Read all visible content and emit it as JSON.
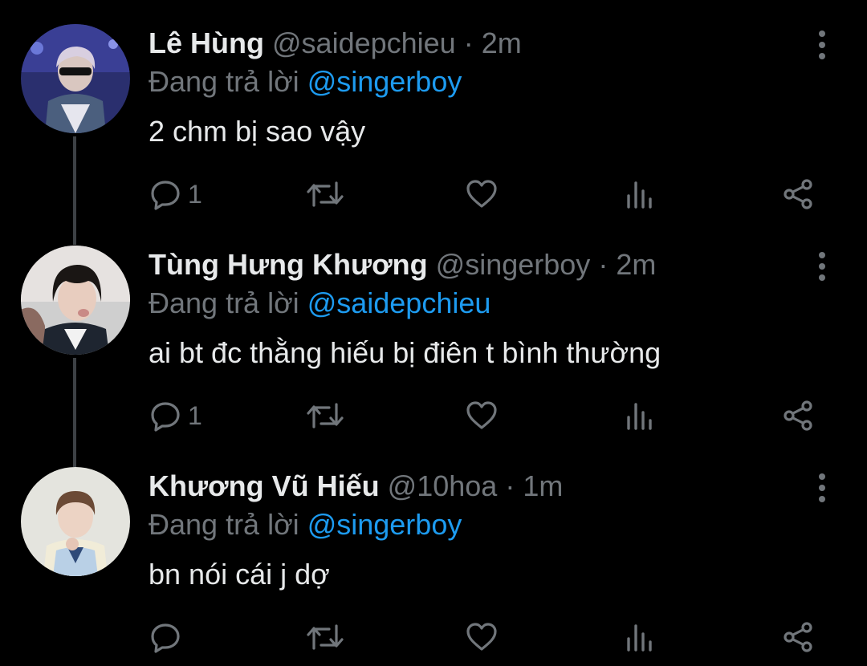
{
  "reply_prefix": "Đang trả lời",
  "colors": {
    "background": "#000000",
    "name": "#e7e9ea",
    "secondary": "#71767b",
    "mention": "#1d9bf0",
    "thread_line": "#3d4145"
  },
  "tweets": [
    {
      "name": "Lê Hùng",
      "handle": "@saidepchieu",
      "separator": "·",
      "time": "2m",
      "reply_to": "@singerboy",
      "text": "2 chm bị sao vậy",
      "reply_count": "1"
    },
    {
      "name": "Tùng Hưng Khương",
      "handle": "@singerboy",
      "separator": "·",
      "time": "2m",
      "reply_to": "@saidepchieu",
      "text": "ai bt đc thằng hiếu bị điên t bình thường",
      "reply_count": "1"
    },
    {
      "name": "Khương Vũ Hiếu",
      "handle": "@10hoa",
      "separator": "·",
      "time": "1m",
      "reply_to": "@singerboy",
      "text": "bn nói cái j dợ",
      "reply_count": ""
    }
  ],
  "icons": [
    "reply-icon",
    "retweet-icon",
    "like-icon",
    "views-icon",
    "share-icon",
    "more-icon"
  ]
}
